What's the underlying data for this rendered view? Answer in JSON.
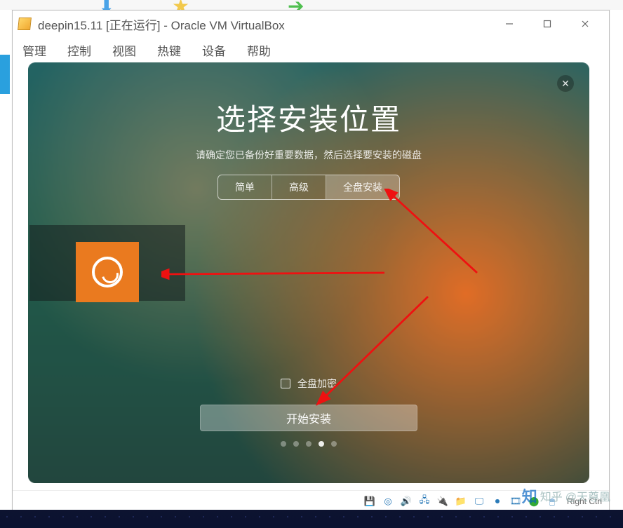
{
  "window": {
    "title": "deepin15.11 [正在运行] - Oracle VM VirtualBox"
  },
  "menubar": {
    "items": [
      "管理",
      "控制",
      "视图",
      "热键",
      "设备",
      "帮助"
    ]
  },
  "installer": {
    "title": "选择安装位置",
    "subtitle": "请确定您已备份好重要数据，然后选择要安装的磁盘",
    "tabs": {
      "simple": "简单",
      "advanced": "高级",
      "fulldisk": "全盘安装"
    },
    "encrypt_label": "全盘加密",
    "start_button": "开始安装",
    "active_step": 4,
    "total_steps": 5
  },
  "statusbar": {
    "key_text": "Right Ctrl"
  },
  "watermark": {
    "site": "知乎",
    "user": "@天尊凰"
  },
  "status_icons": {
    "i0": "hdd-icon",
    "i1": "disc-icon",
    "i2": "audio-icon",
    "i3": "network-icon",
    "i4": "usb-icon",
    "i5": "shared-folder-icon",
    "i6": "display-icon",
    "i7": "record-icon",
    "i8": "video-icon",
    "i9": "cpu-icon",
    "i10": "mouse-icon"
  }
}
